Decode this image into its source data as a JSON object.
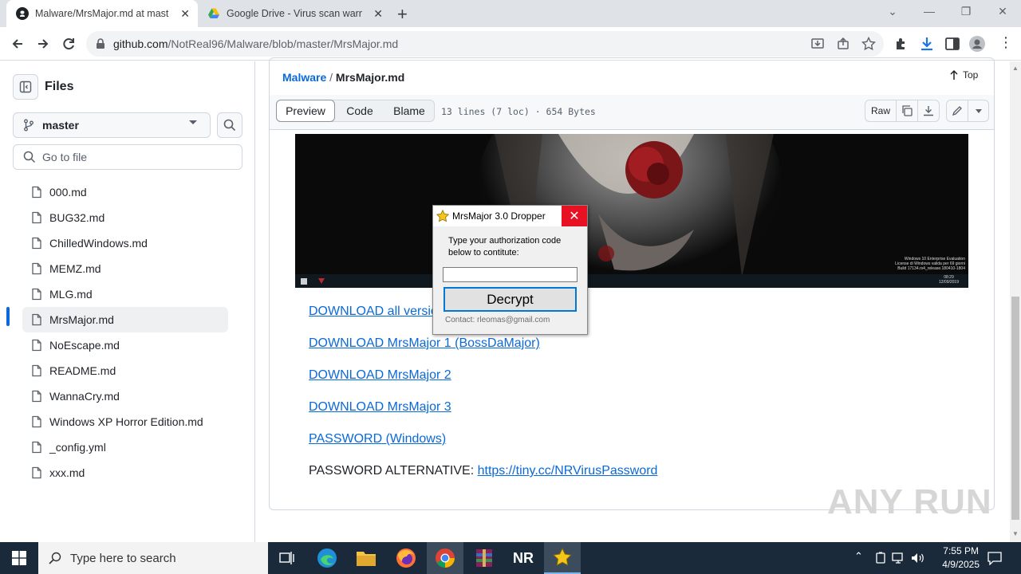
{
  "browser": {
    "tabs": [
      {
        "title": "Malware/MrsMajor.md at maste"
      },
      {
        "title": "Google Drive - Virus scan warnin"
      }
    ],
    "url_host": "github.com",
    "url_path": "/NotReal96/Malware/blob/master/MrsMajor.md"
  },
  "sidebar": {
    "heading": "Files",
    "branch": "master",
    "go_to_file_placeholder": "Go to file",
    "files": [
      "000.md",
      "BUG32.md",
      "ChilledWindows.md",
      "MEMZ.md",
      "MLG.md",
      "MrsMajor.md",
      "NoEscape.md",
      "README.md",
      "WannaCry.md",
      "Windows XP Horror Edition.md",
      "_config.yml",
      "xxx.md"
    ],
    "active_index": 5
  },
  "file": {
    "breadcrumb_repo": "Malware",
    "breadcrumb_sep": "/",
    "breadcrumb_file": "MrsMajor.md",
    "top_label": "Top",
    "tabs": [
      "Preview",
      "Code",
      "Blame"
    ],
    "info": "13 lines (7 loc) · 654 Bytes",
    "raw_label": "Raw",
    "links": [
      "DOWNLOAD all versions",
      "DOWNLOAD MrsMajor 1 (BossDaMajor)",
      "DOWNLOAD MrsMajor 2",
      "DOWNLOAD MrsMajor 3",
      "PASSWORD (Windows)"
    ],
    "alt_label": "PASSWORD ALTERNATIVE: ",
    "alt_link": "https://tiny.cc/NRVirusPassword"
  },
  "dialog": {
    "title": "MrsMajor 3.0 Dropper",
    "prompt": "Type your authorization code below to contitute:",
    "input_value": "",
    "button": "Decrypt",
    "contact": "Contact: rleomas@gmail.com"
  },
  "desktop_screenshot": {
    "watermark_line1": "Windows 10 Enterprise Evaluation",
    "watermark_line2": "License di Windows valida per 69 giorni",
    "watermark_line3": "Build 17134.rs4_release.180410-1804",
    "time": "08:29",
    "date": "12/09/2019"
  },
  "taskbar": {
    "search_placeholder": "Type here to search",
    "time": "7:55 PM",
    "date": "4/9/2025",
    "nr_label": "NR"
  },
  "watermark": "ANY RUN"
}
